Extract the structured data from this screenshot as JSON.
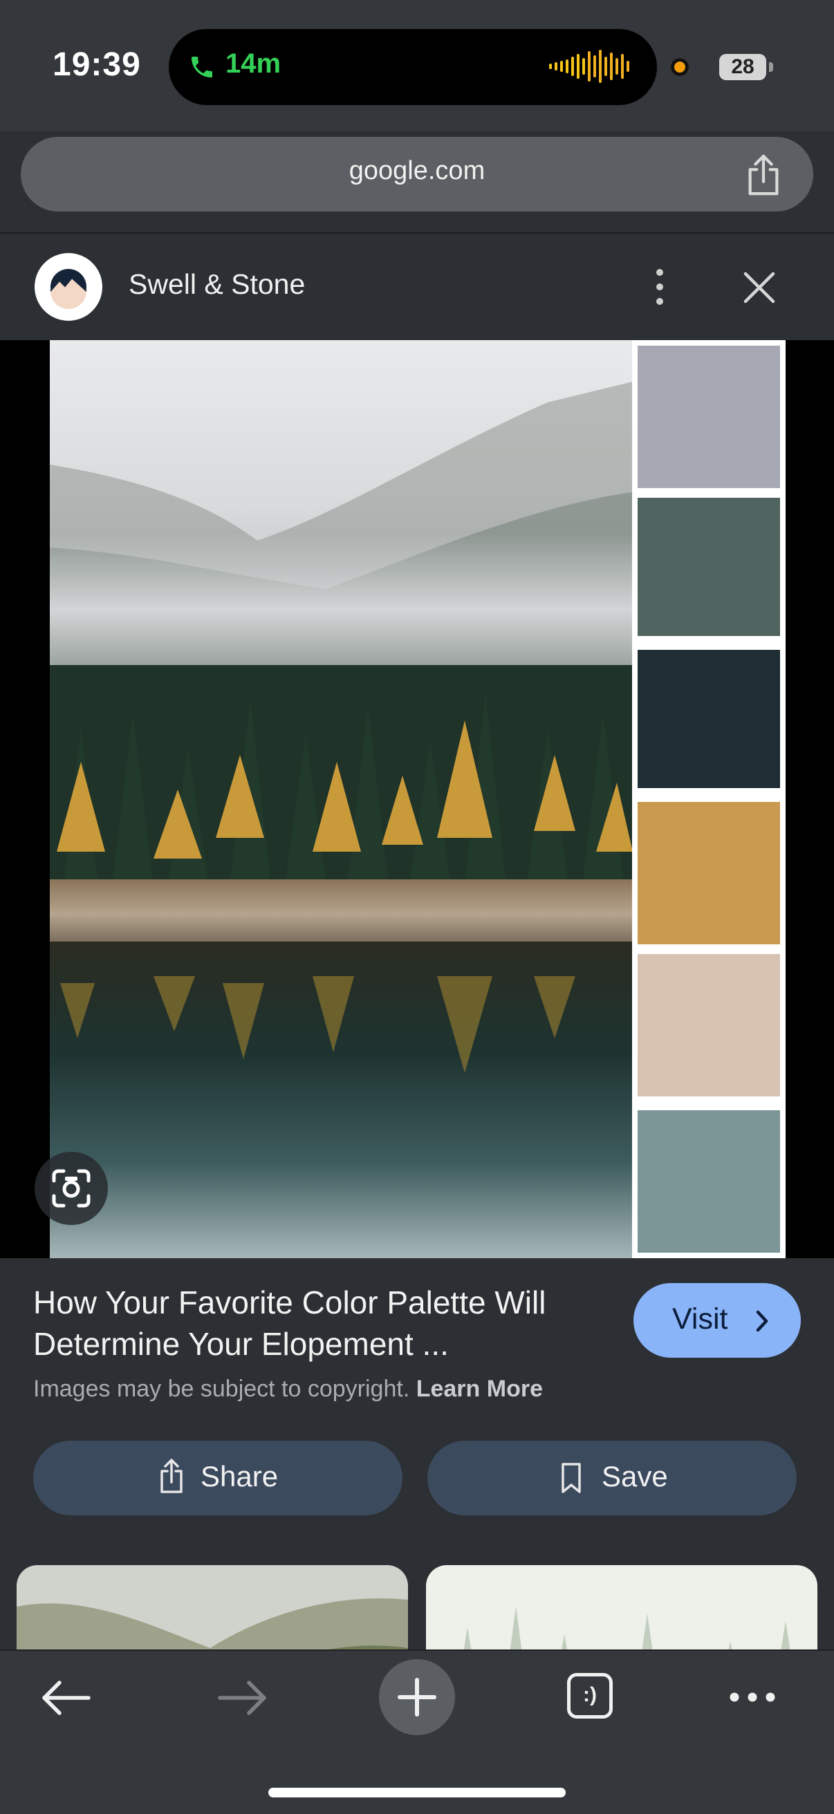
{
  "status": {
    "time": "19:39",
    "call_duration": "14m",
    "battery": "28"
  },
  "browser": {
    "url": "google.com"
  },
  "header": {
    "site_name": "Swell & Stone"
  },
  "palette": [
    "#a6a8b3",
    "#4f645e",
    "#1f2e34",
    "#c99a50",
    "#d8c3b2",
    "#7c9597"
  ],
  "result": {
    "title": "How Your Favorite Color Palette Will Determine Your Elopement ...",
    "visit_label": "Visit",
    "copyright_text": "Images may be subject to copyright.",
    "learn_more": "Learn More",
    "share_label": "Share",
    "save_label": "Save"
  },
  "toolbar": {
    "tabs_label": ":)"
  },
  "colors": {
    "accent": "#8ab4f8",
    "pill": "#3c4a5e",
    "call_green": "#34d158"
  }
}
